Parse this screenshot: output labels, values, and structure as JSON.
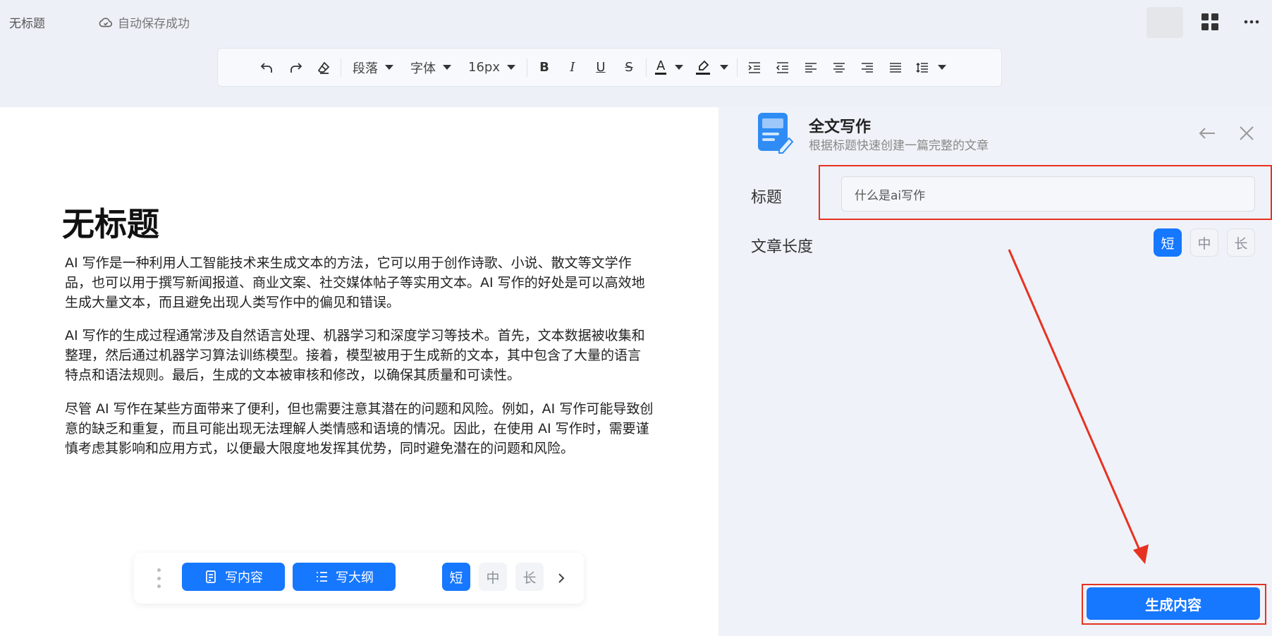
{
  "topbar": {
    "doc_name": "无标题",
    "save_status": "自动保存成功"
  },
  "toolbar": {
    "paragraph": "段落",
    "font": "字体",
    "size": "16px",
    "bold": "B",
    "italic": "I",
    "underline": "U",
    "strike": "S",
    "font_color_letter": "A"
  },
  "editor": {
    "title": "无标题",
    "paragraphs": [
      "AI 写作是一种利用人工智能技术来生成文本的方法，它可以用于创作诗歌、小说、散文等文学作品，也可以用于撰写新闻报道、商业文案、社交媒体帖子等实用文本。AI 写作的好处是可以高效地生成大量文本，而且避免出现人类写作中的偏见和错误。",
      "AI 写作的生成过程通常涉及自然语言处理、机器学习和深度学习等技术。首先，文本数据被收集和整理，然后通过机器学习算法训练模型。接着，模型被用于生成新的文本，其中包含了大量的语言特点和语法规则。最后，生成的文本被审核和修改，以确保其质量和可读性。",
      "尽管 AI 写作在某些方面带来了便利，但也需要注意其潜在的问题和风险。例如，AI 写作可能导致创意的缺乏和重复，而且可能出现无法理解人类情感和语境的情况。因此，在使用 AI 写作时，需要谨慎考虑其影响和应用方式，以便最大限度地发挥其优势，同时避免潜在的问题和风险。"
    ]
  },
  "float_bar": {
    "write_content": "写内容",
    "write_outline": "写大纲",
    "short": "短",
    "medium": "中",
    "long": "长"
  },
  "panel": {
    "title": "全文写作",
    "subtitle": "根据标题快速创建一篇完整的文章",
    "title_label": "标题",
    "title_value": "什么是ai写作",
    "length_label": "文章长度",
    "short": "短",
    "medium": "中",
    "long": "长",
    "generate": "生成内容"
  },
  "colors": {
    "accent": "#1677ff",
    "highlight": "#e63222"
  }
}
